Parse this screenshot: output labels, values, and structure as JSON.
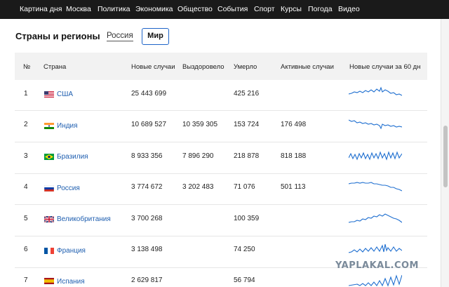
{
  "nav": {
    "items": [
      "Картина дня",
      "Москва",
      "Политика",
      "Экономика",
      "Общество",
      "События",
      "Спорт",
      "Курсы",
      "Погода",
      "Видео"
    ]
  },
  "section": {
    "title": "Страны и регионы",
    "tab_russia": "Россия",
    "tab_world": "Мир",
    "active_tab": "Мир"
  },
  "table": {
    "columns": [
      "№",
      "Страна",
      "Новые случаи",
      "Выздоровело",
      "Умерло",
      "Активные случаи",
      "Новые случаи за 60 дн"
    ],
    "rows": [
      {
        "num": "1",
        "country": "США",
        "flag": "usa-flag",
        "new_cases": "25 443 699",
        "recovered": "",
        "died": "425 216",
        "active": ""
      },
      {
        "num": "2",
        "country": "Индия",
        "flag": "india-flag",
        "new_cases": "10 689 527",
        "recovered": "10 359 305",
        "died": "153 724",
        "active": "176 498"
      },
      {
        "num": "3",
        "country": "Бразилия",
        "flag": "brazil-flag",
        "new_cases": "8 933 356",
        "recovered": "7 896 290",
        "died": "218 878",
        "active": "818 188"
      },
      {
        "num": "4",
        "country": "Россия",
        "flag": "russia-flag",
        "new_cases": "3 774 672",
        "recovered": "3 202 483",
        "died": "71 076",
        "active": "501 113"
      },
      {
        "num": "5",
        "country": "Великобритания",
        "flag": "uk-flag",
        "new_cases": "3 700 268",
        "recovered": "",
        "died": "100 359",
        "active": ""
      },
      {
        "num": "6",
        "country": "Франция",
        "flag": "france-flag",
        "new_cases": "3 138 498",
        "recovered": "",
        "died": "74 250",
        "active": ""
      },
      {
        "num": "7",
        "country": "Испания",
        "flag": "spain-flag",
        "new_cases": "2 629 817",
        "recovered": "",
        "died": "56 794",
        "active": ""
      }
    ]
  },
  "colors": {
    "nav_bg": "#1a1a1a",
    "accent": "#1e64c8",
    "link": "#1f5fb0",
    "sparkline": "#1f6fd0"
  },
  "watermark": "YAPLAKAL.COM"
}
